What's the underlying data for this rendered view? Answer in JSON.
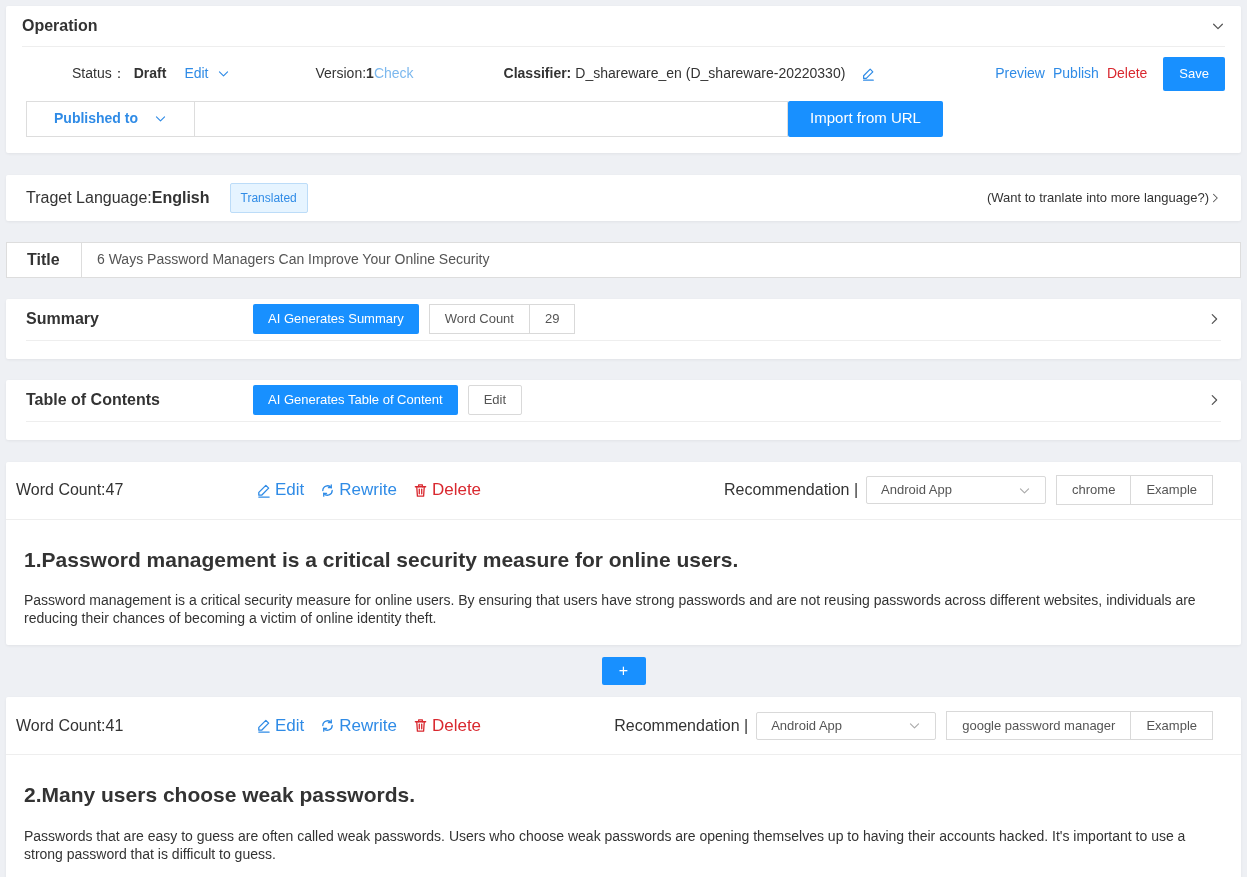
{
  "operation": {
    "title": "Operation",
    "expanded": true,
    "status_label": "Status：",
    "status": "Draft",
    "status_action": "Edit",
    "version_label": "Version:",
    "version": "1",
    "version_action": "Check",
    "classifier_label": "Classifier:",
    "classifier": "D_shareware_en (D_shareware-20220330)",
    "actions": [
      {
        "label": "Preview",
        "kind": "link"
      },
      {
        "label": "Publish",
        "kind": "link"
      },
      {
        "label": "Delete",
        "kind": "danger"
      },
      {
        "label": "Save",
        "kind": "primary"
      }
    ],
    "published_label": "Published to",
    "import_button": "Import from URL"
  },
  "language": {
    "label": "Traget Language:",
    "value": "English",
    "badge": "Translated",
    "more": "(Want to tranlate into more language?)"
  },
  "title_field": {
    "label": "Title",
    "value": "6 Ways Password Managers Can Improve Your Online Security"
  },
  "summary": {
    "title": "Summary",
    "expanded": false,
    "ai_button": "AI Generates Summary",
    "word_count_label": "Word Count",
    "word_count": "29"
  },
  "toc": {
    "title": "Table of Contents",
    "expanded": false,
    "ai_button": "AI Generates Table of Content",
    "edit_button": "Edit"
  },
  "sections": [
    {
      "word_count_label": "Word Count:",
      "word_count": "47",
      "actions": [
        {
          "label": "Edit",
          "kind": "edit"
        },
        {
          "label": "Rewrite",
          "kind": "rewrite"
        },
        {
          "label": "Delete",
          "kind": "delete"
        }
      ],
      "recommendation_label": "Recommendation |",
      "select_value": "Android App",
      "keyword": "chrome",
      "example_button": "Example",
      "heading": "1.Password management is a critical security measure for online users.",
      "body": "Password management is a critical security measure for online users. By ensuring that users have strong passwords and are not reusing passwords across different websites, individuals are reducing their chances of becoming a victim of online identity theft."
    },
    {
      "word_count_label": "Word Count:",
      "word_count": "41",
      "actions": [
        {
          "label": "Edit",
          "kind": "edit"
        },
        {
          "label": "Rewrite",
          "kind": "rewrite"
        },
        {
          "label": "Delete",
          "kind": "delete"
        }
      ],
      "recommendation_label": "Recommendation |",
      "select_value": "Android App",
      "keyword": "google password manager",
      "example_button": "Example",
      "heading": "2.Many users choose weak passwords.",
      "body": "Passwords that are easy to guess are often called weak passwords. Users who choose weak passwords are opening themselves up to having their accounts hacked. It's important to use a strong password that is difficult to guess."
    }
  ],
  "add_button": "+"
}
